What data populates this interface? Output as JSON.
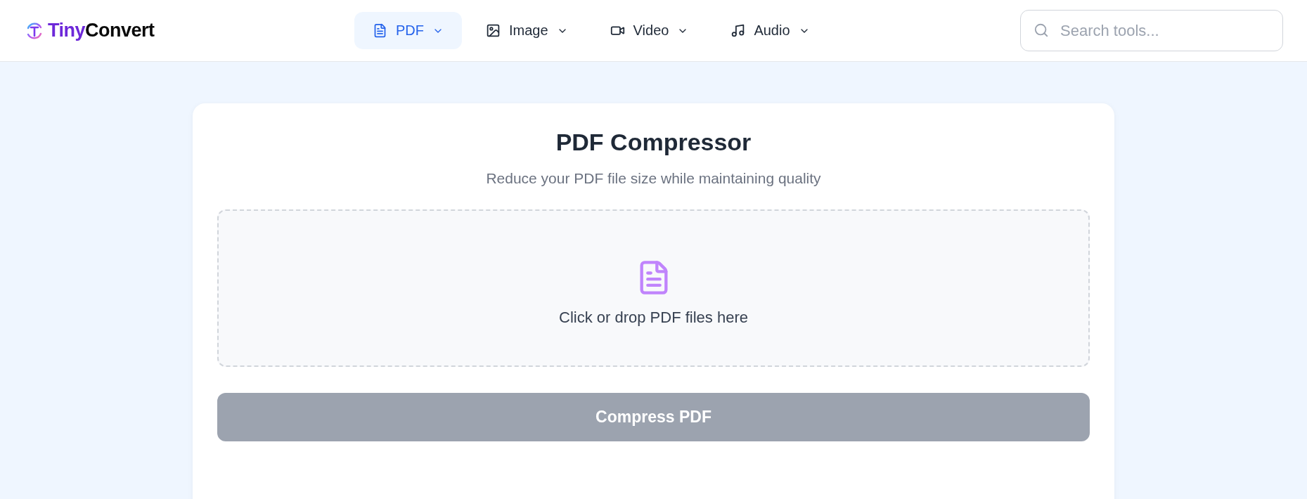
{
  "brand": {
    "lead": "Tiny",
    "rest": "Convert"
  },
  "nav": [
    {
      "label": "PDF",
      "kind": "pdf",
      "selected": true
    },
    {
      "label": "Image",
      "kind": "image",
      "selected": false
    },
    {
      "label": "Video",
      "kind": "video",
      "selected": false
    },
    {
      "label": "Audio",
      "kind": "audio",
      "selected": false
    }
  ],
  "search": {
    "placeholder": "Search tools..."
  },
  "tool": {
    "title": "PDF Compressor",
    "subtitle": "Reduce your PDF file size while maintaining quality",
    "dropzone": "Click or drop PDF files here",
    "button": {
      "label": "Compress PDF",
      "disabled": true
    }
  }
}
